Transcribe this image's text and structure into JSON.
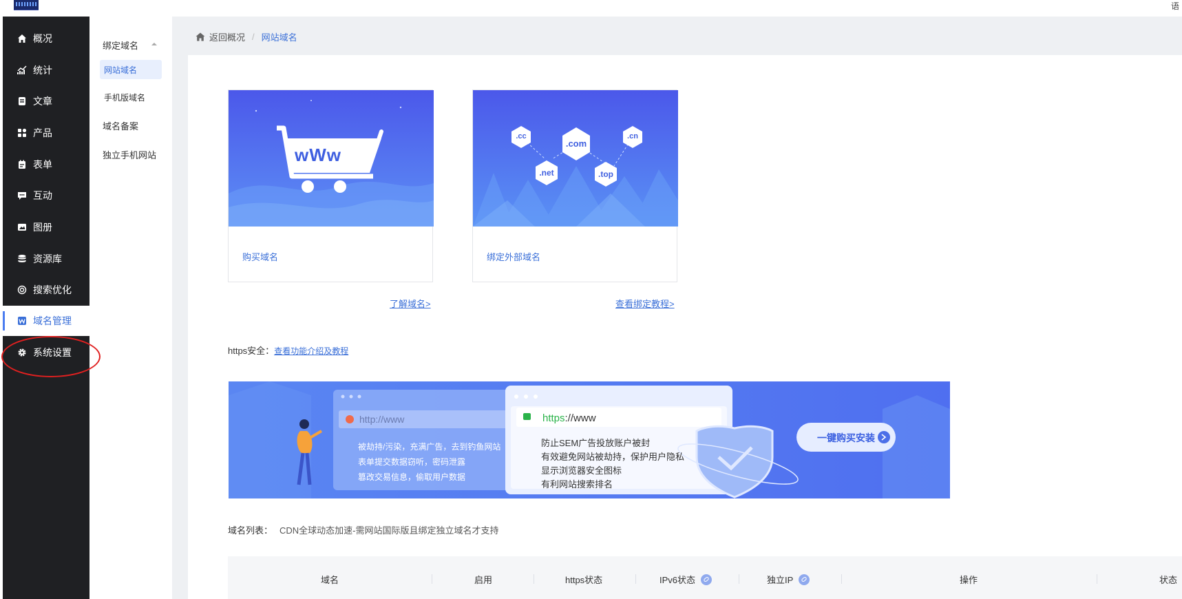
{
  "header": {
    "top_right": "语"
  },
  "sidebar": {
    "items": [
      {
        "label": "概况",
        "icon": "home-icon"
      },
      {
        "label": "统计",
        "icon": "chart-icon"
      },
      {
        "label": "文章",
        "icon": "article-icon"
      },
      {
        "label": "产品",
        "icon": "grid-icon"
      },
      {
        "label": "表单",
        "icon": "form-icon"
      },
      {
        "label": "互动",
        "icon": "chat-icon"
      },
      {
        "label": "图册",
        "icon": "album-icon"
      },
      {
        "label": "资源库",
        "icon": "database-icon"
      },
      {
        "label": "搜索优化",
        "icon": "seo-icon"
      },
      {
        "label": "域名管理",
        "icon": "domain-icon"
      },
      {
        "label": "系统设置",
        "icon": "gear-icon"
      }
    ],
    "active_index": 9
  },
  "subnav": {
    "group": "绑定域名",
    "items": [
      "网站域名",
      "手机版域名",
      "域名备案",
      "独立手机网站"
    ],
    "active_index": 0
  },
  "breadcrumb": {
    "back": "返回概况",
    "separator": "/",
    "current": "网站域名"
  },
  "cards": [
    {
      "label": "购买域名",
      "link": "了解域名>",
      "art_text": "wWw"
    },
    {
      "label": "绑定外部域名",
      "link": "查看绑定教程>",
      "art_tags": [
        ".cc",
        ".com",
        ".cn",
        ".net",
        ".top"
      ]
    }
  ],
  "https": {
    "label": "https安全：",
    "link": "查看功能介绍及教程"
  },
  "banner": {
    "http_url": "http://www",
    "http_points": [
      "被劫持/污染，充满广告，去到钓鱼网站",
      "表单提交数据窃听，密码泄露",
      "篡改交易信息，偷取用户数据"
    ],
    "https_prefix": "https",
    "https_rest": "://www",
    "https_points": [
      "防止SEM广告投放账户被封",
      "有效避免网站被劫持，保护用户隐私",
      "显示浏览器安全图标",
      "有利网站搜索排名"
    ],
    "cta": "一键购买安装"
  },
  "domain_list": {
    "label": "域名列表：",
    "note": "CDN全球动态加速-需网站国际版且绑定独立域名才支持"
  },
  "table": {
    "columns": [
      "域名",
      "启用",
      "https状态",
      "IPv6状态",
      "独立IP",
      "操作",
      "状态"
    ]
  },
  "colors": {
    "accent": "#3a6fd8",
    "sidebar": "#1f2023",
    "annotation": "#e02020"
  }
}
